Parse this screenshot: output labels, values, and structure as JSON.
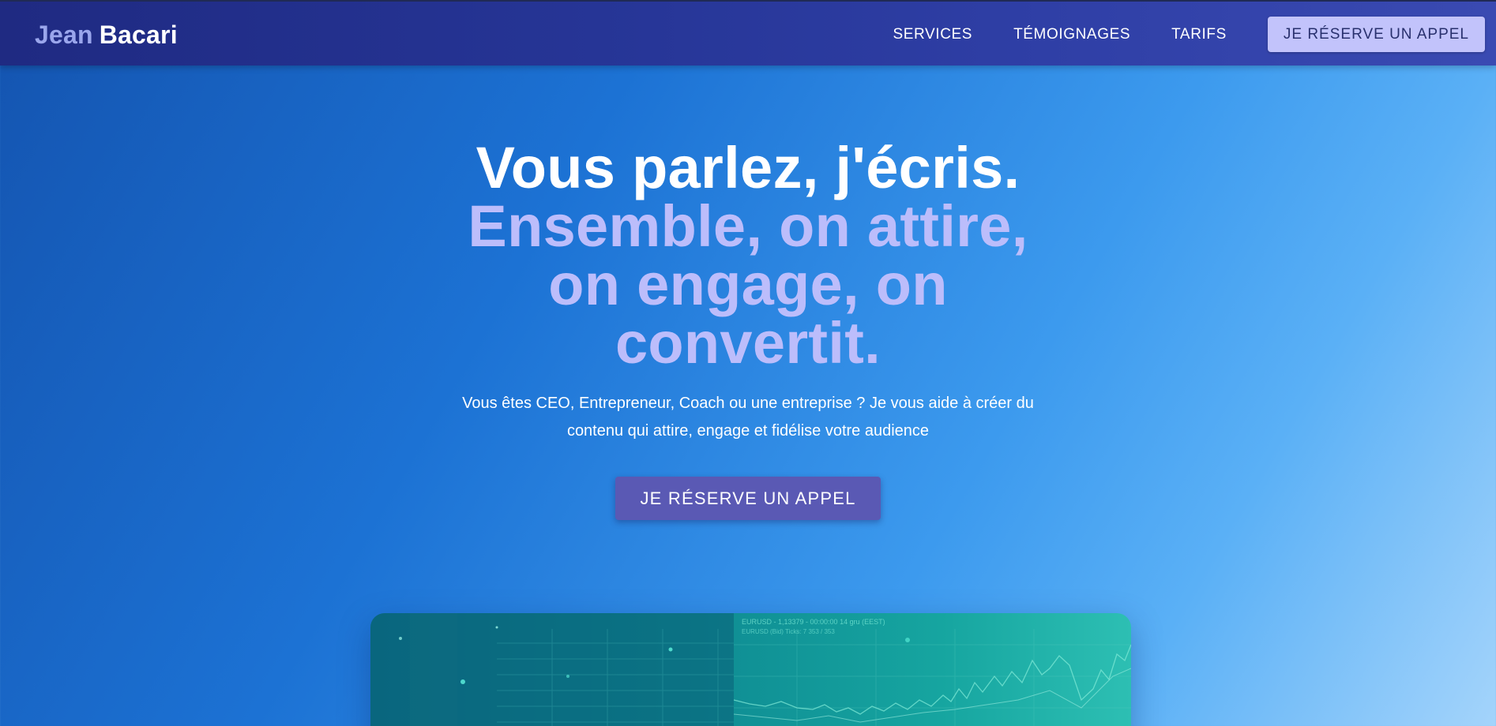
{
  "nav": {
    "logo_first": "Jean",
    "logo_last": "Bacari",
    "links": [
      "SERVICES",
      "TÉMOIGNAGES",
      "TARIFS"
    ],
    "cta": "JE RÉSERVE UN APPEL"
  },
  "hero": {
    "headline_line1": "Vous parlez, j'écris.",
    "headline_accent": "Ensemble, on attire, on engage, on convertit.",
    "subtitle": "Vous êtes CEO, Entrepreneur, Coach ou une entreprise ? Je vous aide à créer du contenu qui attire, engage et fidélise votre audience",
    "cta": "JE RÉSERVE UN APPEL"
  },
  "media": {
    "image_name": "trading-chart-image",
    "chart_header": "EURUSD - 1,13379 - 00:00:00 14 gru (EEST)",
    "chart_subheader": "EURUSD (Bid) Ticks: 7 353 / 353"
  },
  "colors": {
    "accent": "#bcbdfb",
    "nav_cta_bg": "#c2c3fb",
    "hero_cta_bg": "#5a59b4"
  }
}
